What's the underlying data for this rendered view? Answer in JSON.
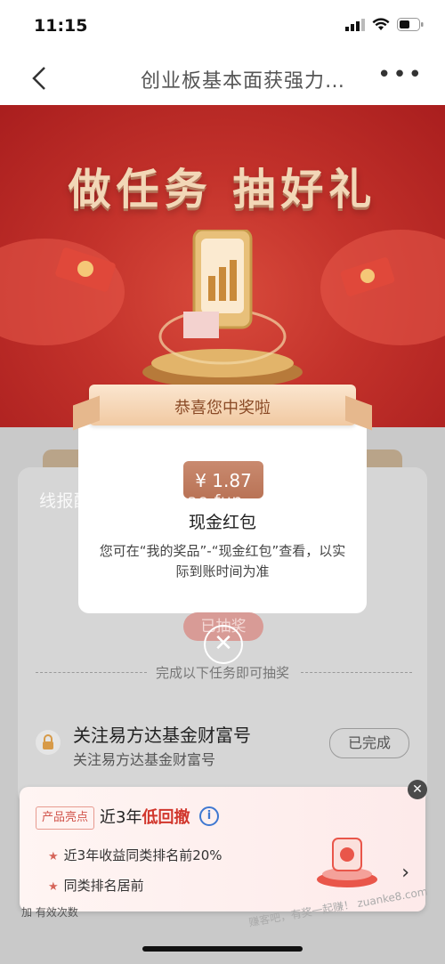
{
  "status_bar": {
    "time": "11:15"
  },
  "nav": {
    "title": "创业板基本面获强力…",
    "more": "•••"
  },
  "hero": {
    "title": "做任务 抽好礼"
  },
  "popup": {
    "banner": "恭喜您中奖啦",
    "amount": "¥ 1.87",
    "prize_name": "现金红包",
    "description": "您可在“我的奖品”-“现金红包”查看，以实际到账时间为准"
  },
  "watermark": "线报酷-new.xianbao.fun",
  "drawn_button": "已抽奖",
  "close_symbol": "✕",
  "task_hint": "完成以下任务即可抽奖",
  "task": {
    "title": "关注易方达基金财富号",
    "subtitle": "关注易方达基金财富号",
    "status": "已完成"
  },
  "promo": {
    "tag": "产品亮点",
    "title_prefix": "近3年",
    "title_highlight": "低回撤",
    "items": [
      "近3年收益同类排名前20%",
      "同类排名居前"
    ],
    "close": "✕",
    "chevron": "›"
  },
  "bottom_text": "加 有效次数",
  "corner_watermark": "赚客吧，有奖一起赚！ zuanke8.com"
}
